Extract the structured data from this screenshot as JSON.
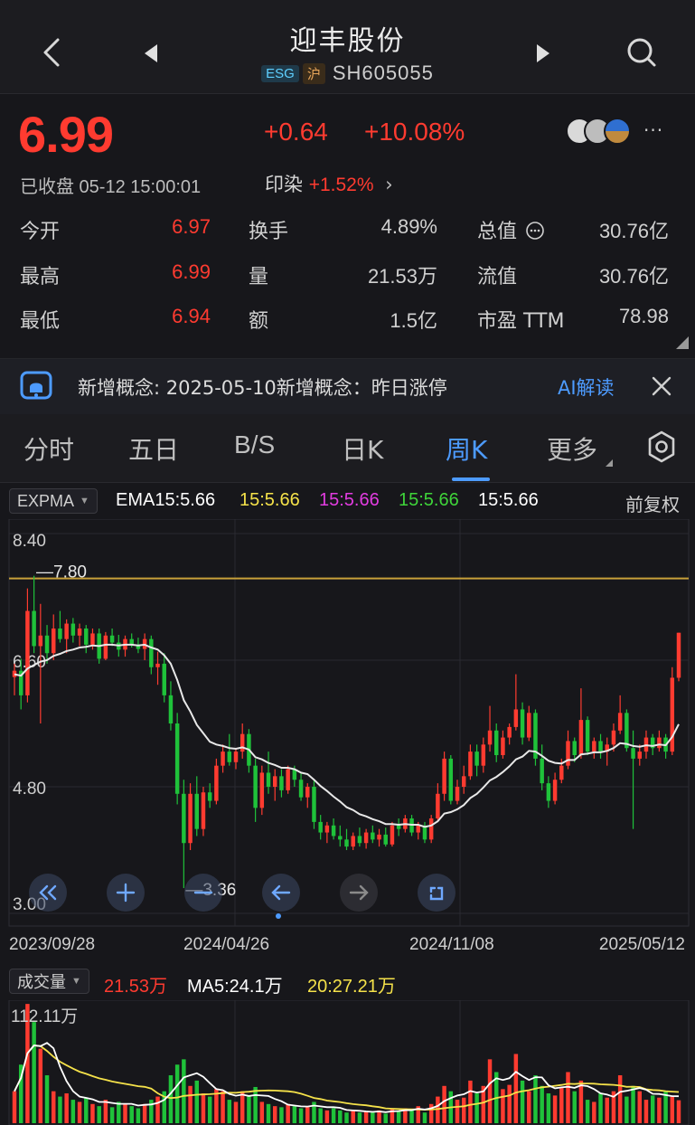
{
  "header": {
    "title": "迎丰股份",
    "badge_esg": "ESG",
    "badge_exchange": "沪",
    "code": "SH605055"
  },
  "quote": {
    "price": "6.99",
    "change": "+0.64",
    "change_pct": "+10.08%",
    "status": "已收盘 05-12 15:00:01",
    "sector_name": "印染",
    "sector_change": "+1.52%",
    "more": "···"
  },
  "stats": {
    "open_label": "今开",
    "open": "6.97",
    "high_label": "最高",
    "high": "6.99",
    "low_label": "最低",
    "low": "6.94",
    "turnover_label": "换手",
    "turnover": "4.89%",
    "volume_label": "量",
    "volume": "21.53万",
    "amount_label": "额",
    "amount": "1.5亿",
    "mktcap_label": "总值",
    "mktcap": "30.76亿",
    "float_label": "流值",
    "float_cap": "30.76亿",
    "pe_label": "市盈 TTM",
    "pe": "78.98"
  },
  "concept": {
    "text": "新增概念: 2025-05-10新增概念：昨日涨停",
    "ai_label": "AI解读"
  },
  "tabs": {
    "fenshi": "分时",
    "wuri": "五日",
    "bs": "B/S",
    "rik": "日K",
    "zhouk": "周K",
    "more": "更多"
  },
  "indicator": {
    "selector": "EXPMA",
    "ema15": "EMA15:5.66",
    "e2": "15:5.66",
    "e3": "15:5.66",
    "e4": "15:5.66",
    "e5": "15:5.66",
    "adjust": "前复权"
  },
  "colors": {
    "up": "#ff3b30",
    "down": "#1fc23a",
    "accent": "#4d9bff",
    "ema15": "#ffffff",
    "ema2": "#f5e24a",
    "ema3": "#e23ce0",
    "ema4": "#3fd43a",
    "ema5": "#ffffff",
    "ma20": "#f5e24a"
  },
  "chart_data": [
    {
      "type": "candlestick",
      "y_axis_labels": [
        "8.40",
        "6.60",
        "4.80",
        "3.00"
      ],
      "ylim": [
        3.0,
        8.4
      ],
      "x_axis_labels": [
        "2023/09/28",
        "2024/04/26",
        "2024/11/08",
        "2025/05/12"
      ],
      "max_marker": "7.80",
      "min_marker": "3.36",
      "grid": true,
      "ohlc": [
        [
          6.36,
          6.55,
          6.1,
          6.45
        ],
        [
          6.45,
          6.62,
          5.9,
          6.1
        ],
        [
          6.1,
          7.62,
          6.0,
          7.3
        ],
        [
          7.3,
          7.8,
          6.7,
          6.8
        ],
        [
          6.8,
          7.4,
          5.7,
          6.95
        ],
        [
          6.95,
          7.1,
          6.55,
          6.7
        ],
        [
          6.7,
          7.25,
          6.6,
          7.05
        ],
        [
          7.05,
          7.3,
          6.85,
          6.9
        ],
        [
          6.9,
          7.18,
          6.7,
          7.12
        ],
        [
          7.12,
          7.2,
          6.85,
          6.95
        ],
        [
          6.95,
          7.12,
          6.8,
          7.05
        ],
        [
          7.05,
          7.1,
          6.7,
          6.82
        ],
        [
          6.82,
          7.05,
          6.75,
          6.98
        ],
        [
          6.98,
          7.05,
          6.55,
          6.62
        ],
        [
          6.62,
          7.0,
          6.6,
          6.95
        ],
        [
          6.95,
          7.05,
          6.8,
          6.85
        ],
        [
          6.85,
          6.96,
          6.65,
          6.75
        ],
        [
          6.75,
          6.95,
          6.65,
          6.9
        ],
        [
          6.9,
          6.98,
          6.78,
          6.82
        ],
        [
          6.82,
          6.92,
          6.7,
          6.76
        ],
        [
          6.76,
          6.98,
          6.6,
          6.9
        ],
        [
          6.9,
          6.95,
          6.4,
          6.5
        ],
        [
          6.5,
          6.72,
          6.25,
          6.55
        ],
        [
          6.55,
          6.7,
          6.0,
          6.1
        ],
        [
          6.1,
          6.3,
          5.6,
          5.7
        ],
        [
          5.7,
          5.85,
          4.55,
          4.7
        ],
        [
          4.7,
          4.9,
          3.36,
          4.0
        ],
        [
          4.0,
          4.85,
          3.9,
          4.7
        ],
        [
          4.7,
          4.95,
          4.1,
          4.2
        ],
        [
          4.2,
          4.8,
          4.1,
          4.72
        ],
        [
          4.72,
          4.85,
          4.5,
          4.6
        ],
        [
          4.6,
          5.2,
          4.55,
          5.1
        ],
        [
          5.1,
          5.4,
          5.0,
          5.3
        ],
        [
          5.3,
          5.55,
          5.1,
          5.15
        ],
        [
          5.15,
          5.35,
          5.05,
          5.3
        ],
        [
          5.3,
          5.7,
          5.2,
          5.55
        ],
        [
          5.55,
          5.62,
          5.0,
          5.1
        ],
        [
          5.1,
          5.2,
          4.3,
          4.5
        ],
        [
          4.5,
          5.1,
          4.4,
          5.0
        ],
        [
          5.0,
          5.3,
          4.7,
          4.8
        ],
        [
          4.8,
          5.05,
          4.6,
          4.95
        ],
        [
          4.95,
          5.05,
          4.65,
          4.75
        ],
        [
          4.75,
          5.1,
          4.7,
          5.05
        ],
        [
          5.05,
          5.1,
          4.8,
          4.9
        ],
        [
          4.9,
          5.0,
          4.6,
          4.65
        ],
        [
          4.65,
          4.85,
          4.5,
          4.8
        ],
        [
          4.8,
          4.9,
          4.2,
          4.3
        ],
        [
          4.3,
          4.4,
          4.05,
          4.15
        ],
        [
          4.15,
          4.3,
          4.0,
          4.25
        ],
        [
          4.25,
          4.35,
          4.05,
          4.1
        ],
        [
          4.1,
          4.25,
          3.95,
          4.05
        ],
        [
          4.05,
          4.2,
          3.9,
          3.95
        ],
        [
          3.95,
          4.15,
          3.9,
          4.1
        ],
        [
          4.1,
          4.22,
          3.95,
          4.0
        ],
        [
          4.0,
          4.2,
          3.92,
          4.15
        ],
        [
          4.15,
          4.25,
          4.0,
          4.05
        ],
        [
          4.05,
          4.2,
          3.95,
          4.12
        ],
        [
          4.12,
          4.22,
          3.95,
          3.98
        ],
        [
          3.98,
          4.3,
          3.95,
          4.25
        ],
        [
          4.25,
          4.35,
          4.1,
          4.2
        ],
        [
          4.2,
          4.4,
          4.15,
          4.35
        ],
        [
          4.35,
          4.4,
          4.1,
          4.15
        ],
        [
          4.15,
          4.3,
          4.05,
          4.25
        ],
        [
          4.25,
          4.3,
          4.0,
          4.05
        ],
        [
          4.05,
          4.4,
          4.0,
          4.35
        ],
        [
          4.35,
          4.85,
          4.3,
          4.7
        ],
        [
          4.7,
          5.3,
          4.6,
          5.2
        ],
        [
          5.2,
          5.25,
          4.55,
          4.6
        ],
        [
          4.6,
          4.9,
          4.55,
          4.8
        ],
        [
          4.8,
          5.1,
          4.7,
          4.95
        ],
        [
          4.95,
          5.4,
          4.9,
          5.3
        ],
        [
          5.3,
          5.4,
          4.95,
          5.1
        ],
        [
          5.1,
          5.5,
          5.0,
          5.4
        ],
        [
          5.4,
          5.95,
          5.3,
          5.6
        ],
        [
          5.6,
          5.7,
          5.15,
          5.25
        ],
        [
          5.25,
          5.6,
          5.2,
          5.5
        ],
        [
          5.5,
          5.7,
          5.4,
          5.65
        ],
        [
          5.65,
          6.4,
          5.6,
          5.9
        ],
        [
          5.9,
          6.0,
          5.4,
          5.5
        ],
        [
          5.5,
          5.95,
          5.45,
          5.85
        ],
        [
          5.85,
          5.9,
          5.1,
          5.2
        ],
        [
          5.2,
          5.4,
          4.75,
          4.85
        ],
        [
          4.85,
          4.95,
          4.5,
          4.6
        ],
        [
          4.6,
          5.0,
          4.55,
          4.9
        ],
        [
          4.9,
          5.2,
          4.85,
          5.1
        ],
        [
          5.1,
          5.6,
          5.05,
          5.45
        ],
        [
          5.45,
          5.5,
          5.15,
          5.25
        ],
        [
          5.25,
          6.2,
          5.2,
          5.75
        ],
        [
          5.75,
          5.8,
          5.25,
          5.3
        ],
        [
          5.3,
          5.5,
          5.2,
          5.45
        ],
        [
          5.45,
          5.55,
          5.2,
          5.3
        ],
        [
          5.3,
          5.5,
          5.1,
          5.4
        ],
        [
          5.4,
          5.7,
          5.3,
          5.6
        ],
        [
          5.6,
          6.1,
          5.55,
          5.85
        ],
        [
          5.85,
          5.9,
          5.3,
          5.35
        ],
        [
          5.35,
          5.6,
          4.2,
          5.2
        ],
        [
          5.2,
          5.4,
          5.1,
          5.3
        ],
        [
          5.3,
          5.6,
          5.2,
          5.5
        ],
        [
          5.5,
          5.55,
          5.25,
          5.35
        ],
        [
          5.35,
          5.6,
          5.3,
          5.5
        ],
        [
          5.5,
          5.55,
          5.2,
          5.3
        ],
        [
          5.3,
          6.5,
          5.25,
          6.35
        ],
        [
          6.35,
          6.99,
          6.3,
          6.99
        ]
      ],
      "ema15": [
        6.4,
        6.38,
        6.48,
        6.53,
        6.58,
        6.6,
        6.66,
        6.69,
        6.73,
        6.75,
        6.78,
        6.79,
        6.81,
        6.8,
        6.82,
        6.82,
        6.81,
        6.82,
        6.82,
        6.81,
        6.82,
        6.78,
        6.75,
        6.67,
        6.55,
        6.32,
        6.03,
        5.87,
        5.68,
        5.56,
        5.44,
        5.4,
        5.38,
        5.35,
        5.34,
        5.36,
        5.33,
        5.22,
        5.19,
        5.14,
        5.11,
        5.07,
        5.07,
        5.05,
        5.0,
        4.98,
        4.9,
        4.81,
        4.74,
        4.66,
        4.59,
        4.51,
        4.47,
        4.41,
        4.38,
        4.34,
        4.31,
        4.27,
        4.27,
        4.26,
        4.27,
        4.26,
        4.26,
        4.23,
        4.25,
        4.31,
        4.42,
        4.44,
        4.48,
        4.54,
        4.64,
        4.7,
        4.79,
        4.89,
        4.94,
        5.01,
        5.09,
        5.19,
        5.23,
        5.31,
        5.3,
        5.24,
        5.17,
        5.14,
        5.13,
        5.18,
        5.18,
        5.26,
        5.27,
        5.29,
        5.29,
        5.31,
        5.35,
        5.42,
        5.41,
        5.38,
        5.37,
        5.39,
        5.38,
        5.4,
        5.39,
        5.51,
        5.69
      ]
    },
    {
      "type": "bar",
      "title": "成交量",
      "y_axis_label": "112.11万",
      "ylim": [
        0,
        112.11
      ],
      "series": [
        {
          "name": "成交量",
          "values": [
            30,
            55,
            112,
            95,
            70,
            45,
            30,
            25,
            28,
            22,
            20,
            24,
            18,
            16,
            22,
            15,
            20,
            18,
            16,
            14,
            18,
            22,
            25,
            30,
            45,
            55,
            60,
            35,
            40,
            28,
            25,
            32,
            30,
            22,
            20,
            30,
            26,
            34,
            20,
            18,
            16,
            15,
            18,
            16,
            14,
            15,
            20,
            14,
            12,
            14,
            12,
            10,
            12,
            10,
            11,
            10,
            12,
            9,
            14,
            12,
            14,
            12,
            16,
            10,
            18,
            25,
            35,
            30,
            22,
            24,
            40,
            28,
            35,
            60,
            48,
            32,
            36,
            65,
            40,
            30,
            45,
            35,
            28,
            26,
            34,
            48,
            30,
            40,
            22,
            20,
            28,
            24,
            30,
            45,
            25,
            35,
            30,
            22,
            26,
            24,
            30,
            25,
            21.53
          ]
        },
        {
          "name": "MA5",
          "last": "MA5:24.1万"
        },
        {
          "name": "MA20",
          "last": "20:27.21万"
        }
      ],
      "last_volume": "21.53万"
    }
  ]
}
